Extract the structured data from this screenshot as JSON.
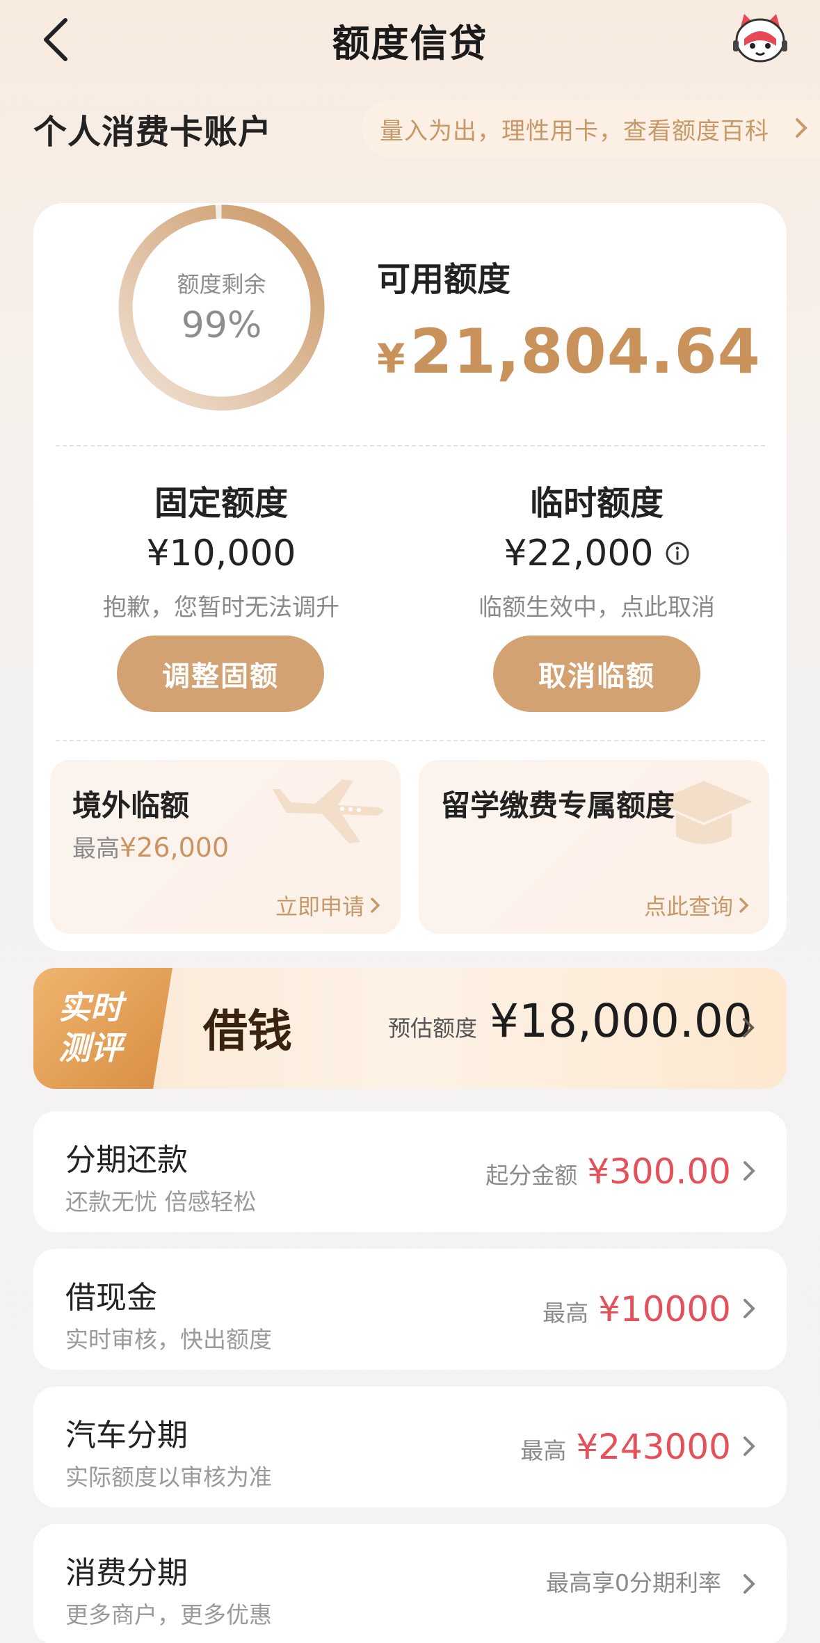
{
  "header": {
    "title": "额度信贷"
  },
  "account": {
    "title": "个人消费卡账户",
    "tip": "量入为出，理性用卡，查看额度百科"
  },
  "summary": {
    "ring_label": "额度剩余",
    "ring_percent_text": "99%",
    "ring_fraction": 0.99,
    "available_label": "可用额度",
    "available_currency": "¥",
    "available_amount": "21,804.64"
  },
  "fixed": {
    "title": "固定额度",
    "amount": "¥10,000",
    "note": "抱歉，您暂时无法调升",
    "button": "调整固额"
  },
  "temp": {
    "title": "临时额度",
    "amount": "¥22,000",
    "note": "临额生效中，点此取消",
    "button": "取消临额"
  },
  "overseas": {
    "title": "境外临额",
    "prefix": "最高",
    "amount": "¥26,000",
    "link": "立即申请"
  },
  "study": {
    "title": "留学缴费专属额度",
    "link": "点此查询"
  },
  "promo": {
    "tag_line1": "实时",
    "tag_line2": "测评",
    "title": "借钱",
    "estimate_label": "预估额度",
    "estimate_amount": "¥18,000.00"
  },
  "services": [
    {
      "title": "分期还款",
      "subtitle": "还款无忧 倍感轻松",
      "prefix": "起分金额",
      "value": "¥300.00"
    },
    {
      "title": "借现金",
      "subtitle": "实时审核，快出额度",
      "prefix": "最高",
      "value": "¥10000"
    },
    {
      "title": "汽车分期",
      "subtitle": "实际额度以审核为准",
      "prefix": "最高",
      "value": "¥243000"
    },
    {
      "title": "消费分期",
      "subtitle": "更多商户，更多优惠",
      "prefix": "最高享0分期利率",
      "value": ""
    }
  ],
  "colors": {
    "accent": "#c8925a",
    "button": "#d2a273",
    "highlight": "#e4515a"
  }
}
